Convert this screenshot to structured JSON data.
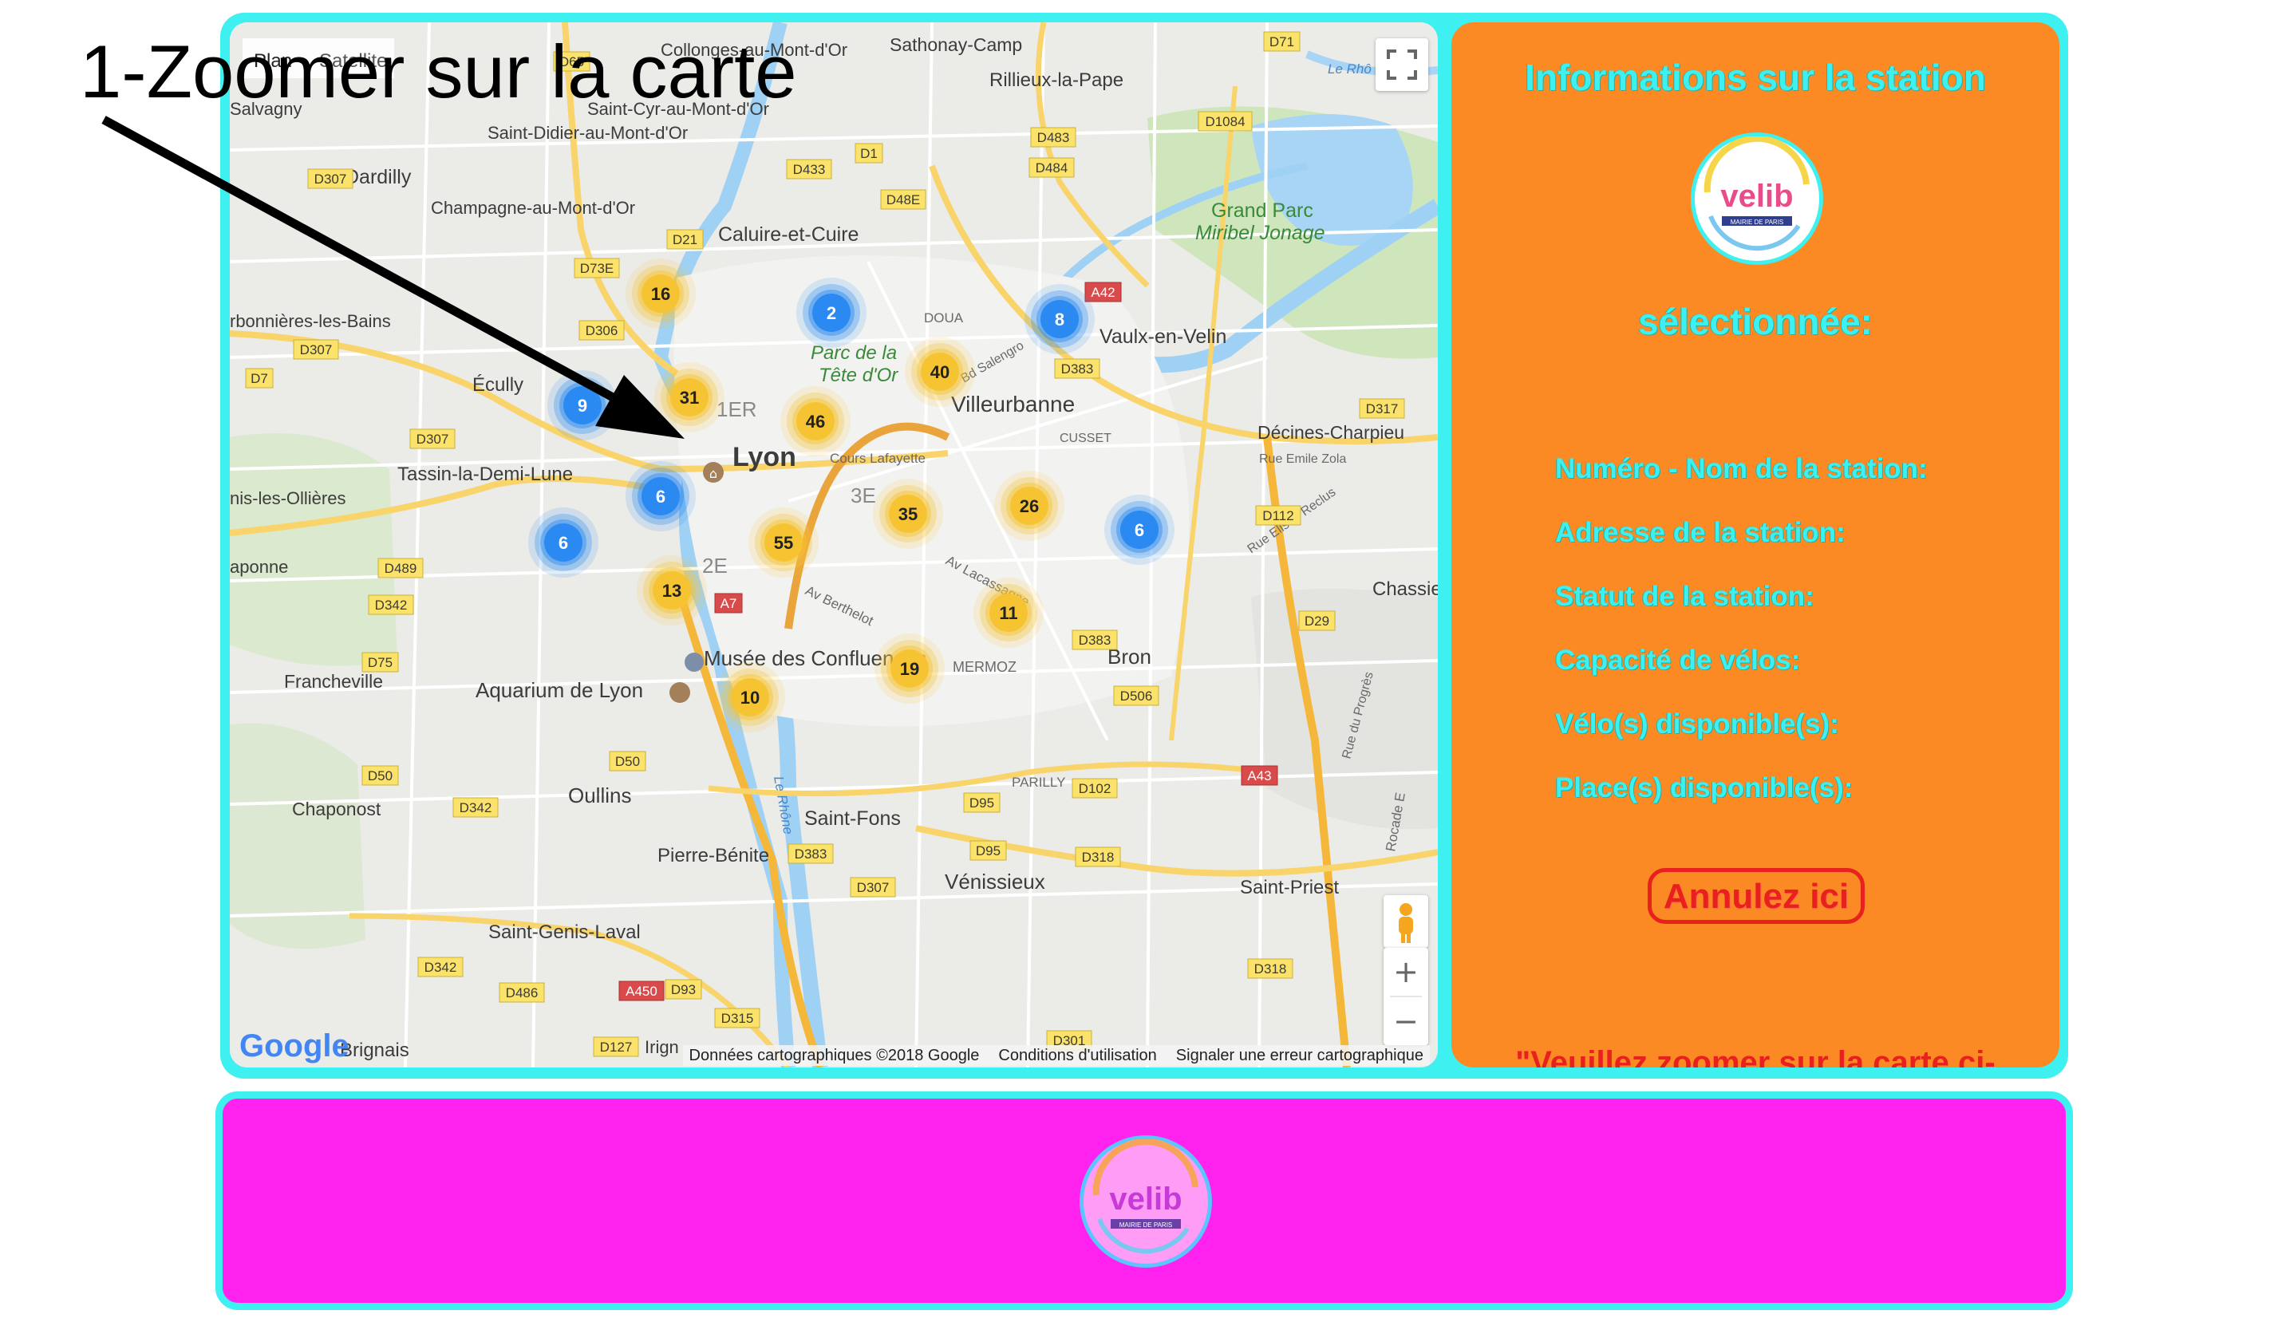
{
  "annotation": {
    "text": "1-Zoomer sur la carte"
  },
  "map": {
    "labels": {
      "lyon": "Lyon",
      "villeurbanne": "Villeurbanne",
      "caluire": "Caluire-et-Cuire",
      "vaulx": "Vaulx-en-Velin",
      "rillieux": "Rillieux-la-Pape",
      "sathonay": "Sathonay-Camp",
      "collonges": "Collonges-au-Mont-d'Or",
      "saint_cyr": "Saint-Cyr-au-Mont-d'Or",
      "saint_didier": "Saint-Didier-au-Mont-d'Or",
      "champagne": "Champagne-au-Mont-d'Or",
      "dardilly": "Dardilly",
      "salvagny": "Salvagny",
      "charbonnieres": "rbonnières-les-Bains",
      "ecully": "Écully",
      "tassin": "Tassin-la-Demi-Lune",
      "ollieres": "nis-les-Ollières",
      "japonne": "aponne",
      "francheville": "Francheville",
      "aquarium": "Aquarium de Lyon",
      "musee": "Musée des Confluences",
      "oullins": "Oullins",
      "chaponost": "Chaponost",
      "pierre_benite": "Pierre-Bénite",
      "saint_genis": "Saint-Genis-Laval",
      "brignais": "Brignais",
      "irigny": "Irign",
      "saint_fons": "Saint-Fons",
      "venissieux": "Vénissieux",
      "bron": "Bron",
      "saint_priest": "Saint-Priest",
      "chassieu": "Chassie",
      "decines": "Décines-Charpieu",
      "grand_parc": "Grand Parc",
      "miribel": "Miribel Jonage",
      "parc_tete_dor": "Parc de la",
      "parc_tete_dor2": "Tête d'Or",
      "first": "1ER",
      "second": "2E",
      "third": "3E",
      "cusset": "CUSSET",
      "mermoz": "MERMOZ",
      "parilly": "PARILLY",
      "doua": "DOUA",
      "cours_lafayette": "Cours Lafayette",
      "av_lacassagne": "Av Lacassagne",
      "av_berthelot": "Av Berthelot",
      "rue_emile_zola": "Rue Emile Zola",
      "rue_elisee_reclus": "Rue Elisée Reclus",
      "rue_du_progres": "Rue du Progrès",
      "rocade_e": "Rocade E",
      "le_rhone": "Le Rhône",
      "le_rhone2": "Le Rhô",
      "bd_salengro": "Bd Salengro",
      "plan": "Plan",
      "satellite": "Satellite"
    },
    "road_badges": [
      "D65",
      "D71",
      "D307",
      "D1084",
      "D433",
      "D1",
      "D483",
      "D484",
      "D48E",
      "D21",
      "D73E",
      "A42",
      "D306",
      "D307",
      "D383",
      "D7",
      "D317",
      "D307",
      "D112",
      "D489",
      "D342",
      "D29",
      "D75",
      "A7",
      "D383",
      "D506",
      "D50",
      "D342",
      "D50",
      "A43",
      "D95",
      "D102",
      "D383",
      "D95",
      "D318",
      "D307",
      "D342",
      "D93",
      "D318",
      "A450",
      "D486",
      "D315",
      "D301",
      "D127"
    ],
    "clusters": [
      {
        "count": "16",
        "color": "yellow"
      },
      {
        "count": "2",
        "color": "blue"
      },
      {
        "count": "8",
        "color": "blue"
      },
      {
        "count": "9",
        "color": "blue"
      },
      {
        "count": "31",
        "color": "yellow"
      },
      {
        "count": "46",
        "color": "yellow"
      },
      {
        "count": "40",
        "color": "yellow"
      },
      {
        "count": "6",
        "color": "blue"
      },
      {
        "count": "6",
        "color": "blue"
      },
      {
        "count": "55",
        "color": "yellow"
      },
      {
        "count": "35",
        "color": "yellow"
      },
      {
        "count": "26",
        "color": "yellow"
      },
      {
        "count": "6",
        "color": "blue"
      },
      {
        "count": "13",
        "color": "yellow"
      },
      {
        "count": "11",
        "color": "yellow"
      },
      {
        "count": "19",
        "color": "yellow"
      },
      {
        "count": "10",
        "color": "yellow"
      }
    ],
    "footer": {
      "data": "Données cartographiques ©2018 Google",
      "terms": "Conditions d'utilisation",
      "report": "Signaler une erreur cartographique"
    },
    "google_logo": "Google",
    "zoom_in": "+",
    "zoom_out": "−"
  },
  "panel": {
    "title": "Informations sur la station",
    "subtitle": "sélectionnée:",
    "fields": [
      "Numéro - Nom de la station:",
      "Adresse de la station:",
      "Statut de la station:",
      "Capacité de vélos:",
      "Vélo(s) disponible(s):",
      "Place(s) disponible(s):"
    ],
    "cancel_label": "Annulez ici",
    "zoom_notice": "\"Veuillez zoomer sur la carte ci-"
  },
  "logo": {
    "word": "velib",
    "sub": "MAIRIE DE PARIS"
  },
  "colors": {
    "cyan": "#3ff0f0",
    "orange": "#fb8a25",
    "magenta": "#ff21ee",
    "red": "#e8211f",
    "cluster_yellow": "#f6c433",
    "cluster_blue": "#2b8af2"
  },
  "icons": [
    "fullscreen-icon",
    "pegman-icon",
    "museum-icon",
    "arrow-icon"
  ]
}
